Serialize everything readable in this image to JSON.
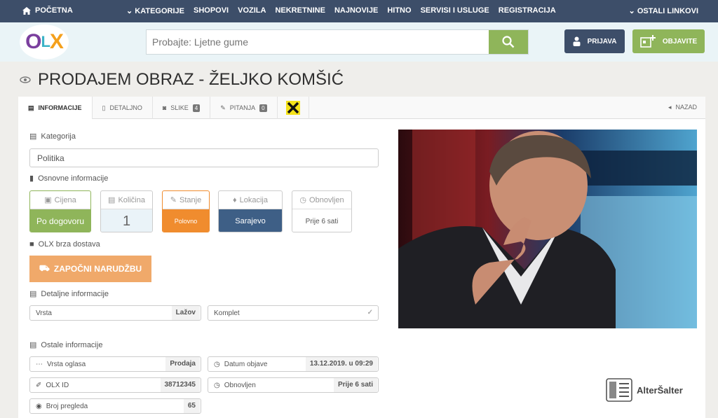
{
  "nav": {
    "home": "POČETNA",
    "categories": [
      "KATEGORIJE",
      "SHOPOVI",
      "VOZILA",
      "NEKRETNINE",
      "NAJNOVIJE",
      "HITNO",
      "SERVISI I USLUGE",
      "REGISTRACIJA"
    ],
    "other_links": "OSTALI LINKOVI"
  },
  "header": {
    "logo": {
      "o": "O",
      "l": "L",
      "x": "X"
    },
    "search_placeholder": "Probajte: Ljetne gume",
    "login_label": "PRIJAVA",
    "post_label": "OBJAVITE"
  },
  "listing": {
    "title": "PRODAJEM OBRAZ - ŽELJKO KOMŠIĆ"
  },
  "tabs": {
    "info": "INFORMACIJE",
    "detail": "DETALJNO",
    "images": "SLIKE",
    "images_count": "4",
    "questions": "PITANJA",
    "questions_count": "0",
    "back": "NAZAD"
  },
  "info": {
    "category_label": "Kategorija",
    "category_value": "Politika",
    "basic_label": "Osnovne informacije",
    "boxes": [
      {
        "label": "Cijena",
        "value": "Po dogovoru"
      },
      {
        "label": "Količina",
        "value": "1"
      },
      {
        "label": "Stanje",
        "value": "Polovno"
      },
      {
        "label": "Lokacija",
        "value": "Sarajevo"
      },
      {
        "label": "Obnovljen",
        "value": "Prije 6 sati"
      }
    ],
    "delivery_label": "OLX brza dostava",
    "order_button": "ZAPOČNI NARUDŽBU",
    "detail_label": "Detaljne informacije",
    "detail_rows": [
      {
        "key": "Vrsta",
        "value": "Lažov"
      },
      {
        "key": "Komplet",
        "value": "✓"
      }
    ],
    "other_label": "Ostale informacije",
    "other_rows": [
      {
        "key": "Vrsta oglasa",
        "value": "Prodaja"
      },
      {
        "key": "Datum objave",
        "value": "13.12.2019. u 09:29"
      },
      {
        "key": "OLX ID",
        "value": "38712345"
      },
      {
        "key": "Obnovljen",
        "value": "Prije 6 sati"
      },
      {
        "key": "Broj pregleda",
        "value": "65"
      }
    ]
  },
  "watermark": "AlterŠalter",
  "colors": {
    "nav": "#3d4e69",
    "green": "#8fb55a",
    "orange": "#f08c2e",
    "blue": "#3e5f86"
  }
}
